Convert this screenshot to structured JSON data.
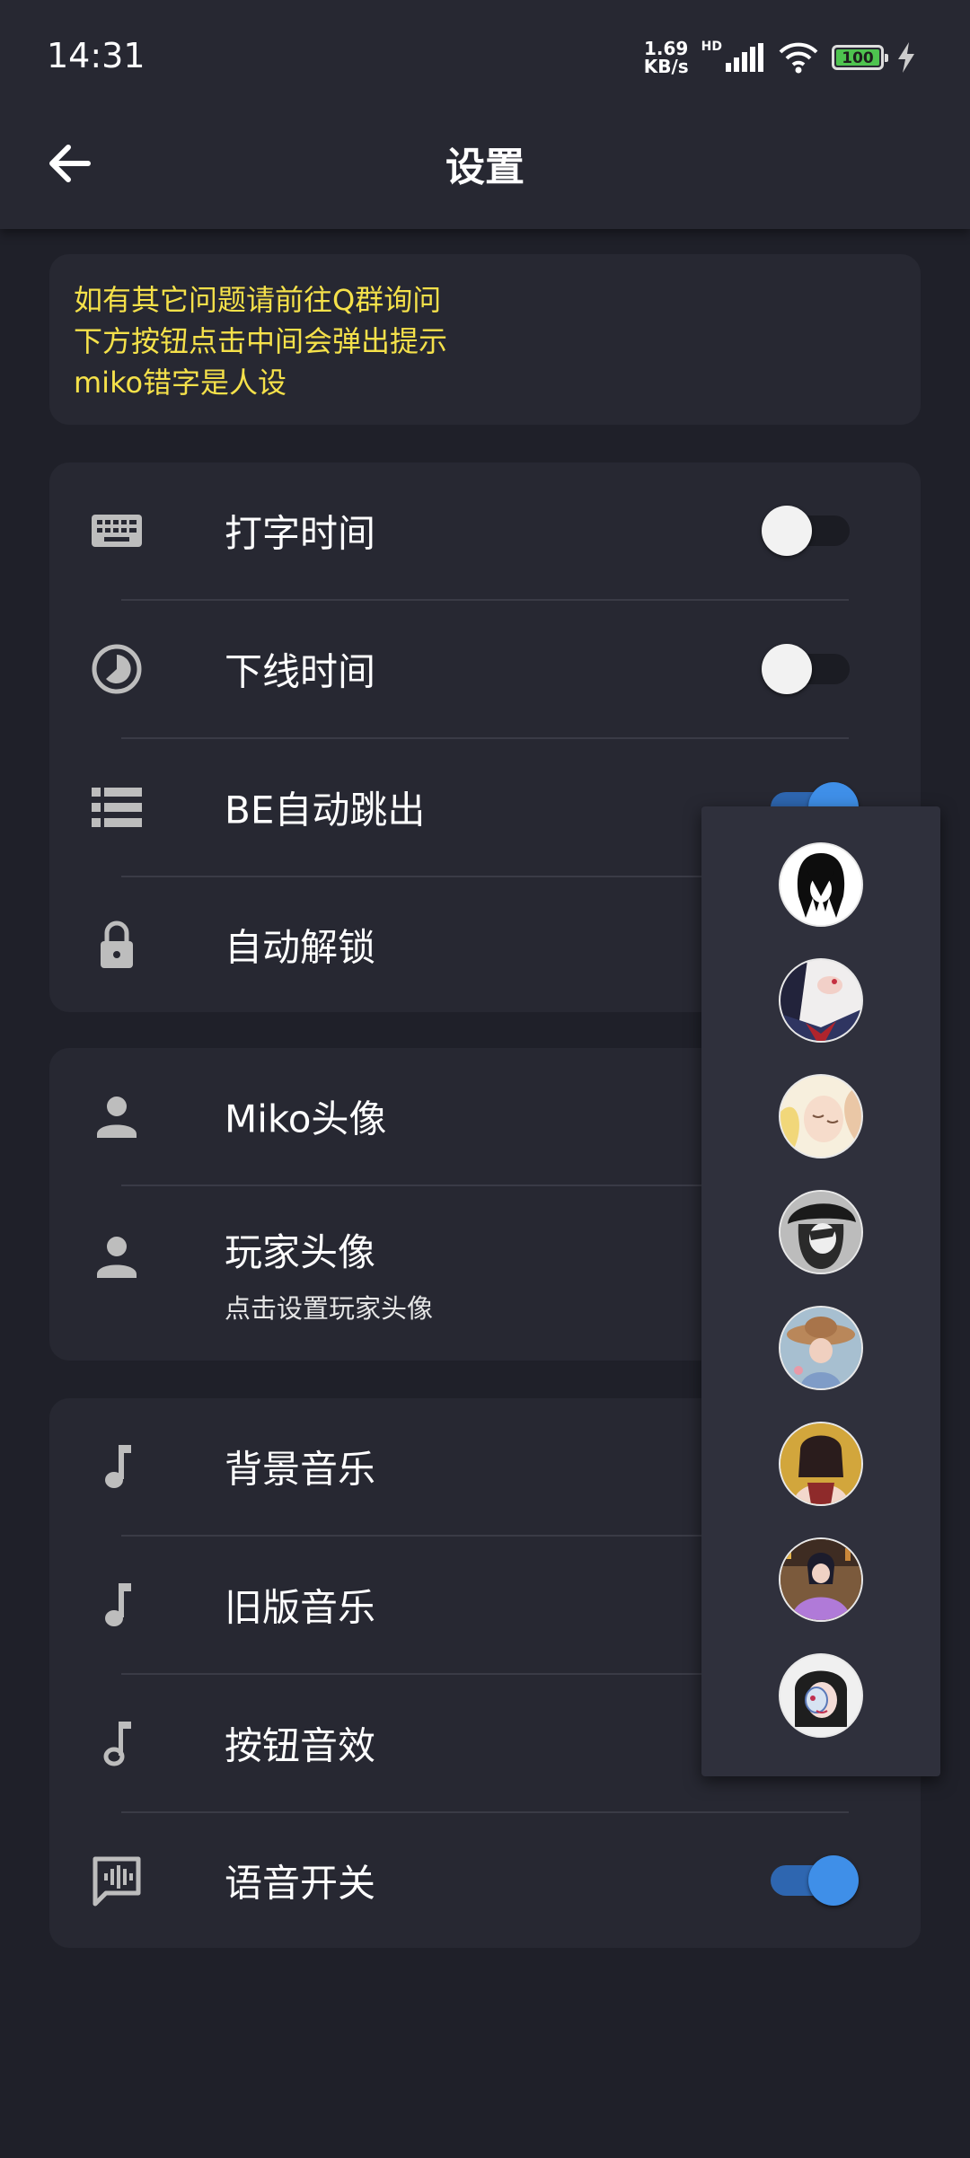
{
  "status": {
    "time": "14:31",
    "speed_value": "1.69",
    "speed_unit": "KB/s",
    "network": "HD",
    "battery": "100"
  },
  "header": {
    "title": "设置"
  },
  "notice": {
    "lines": [
      "如有其它问题请前往Q群询问",
      "下方按钮点击中间会弹出提示",
      "miko错字是人设"
    ],
    "color": "#f5e14a"
  },
  "section1": {
    "typing_time": {
      "label": "打字时间",
      "enabled": false
    },
    "offline_time": {
      "label": "下线时间",
      "enabled": false
    },
    "be_auto_skip": {
      "label": "BE自动跳出",
      "enabled": true
    },
    "auto_unlock": {
      "label": "自动解锁"
    }
  },
  "section2": {
    "miko_avatar": {
      "label": "Miko头像"
    },
    "player_avatar": {
      "label": "玩家头像",
      "sub": "点击设置玩家头像"
    }
  },
  "section3": {
    "bg_music": {
      "label": "背景音乐"
    },
    "old_music": {
      "label": "旧版音乐"
    },
    "button_sfx": {
      "label": "按钮音效"
    },
    "voice": {
      "label": "语音开关",
      "enabled": true
    }
  },
  "avatar_popup": {
    "options": [
      "avatar-option-1",
      "avatar-option-2",
      "avatar-option-3",
      "avatar-option-4",
      "avatar-option-5",
      "avatar-option-6",
      "avatar-option-7",
      "avatar-option-8"
    ]
  },
  "colors": {
    "accent": "#3f8fe8",
    "background": "#1f2029",
    "card": "#272832",
    "notice_text": "#f5e14a"
  }
}
